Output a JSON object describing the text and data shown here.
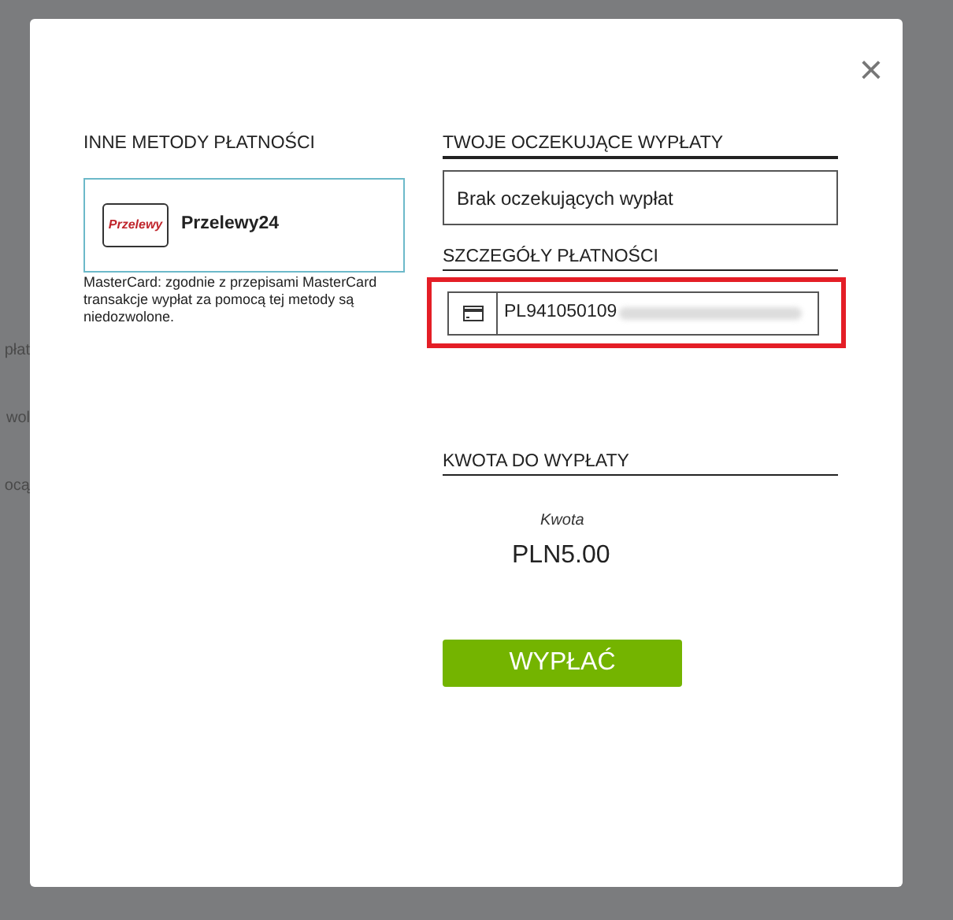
{
  "background_texts": [
    "płat",
    "wol",
    "ocą"
  ],
  "dialog": {
    "close": "×",
    "other_methods": {
      "heading": "INNE METODY PŁATNOŚCI",
      "methods": [
        {
          "logo": "Przelewy",
          "name": "Przelewy24",
          "selected": true
        }
      ],
      "note": "MasterCard: zgodnie z przepisami MasterCard transakcje wypłat za pomocą tej metody są niedozwolone."
    },
    "pending": {
      "heading": "TWOJE OCZEKUJĄCE WYPŁATY",
      "message": "Brak oczekujących wypłat"
    },
    "payment_details": {
      "heading": "SZCZEGÓŁY PŁATNOŚCI",
      "account_value": "PL941050109",
      "highlighted": true
    },
    "amount": {
      "heading": "KWOTA DO WYPŁATY",
      "label": "Kwota",
      "value": "PLN5.00"
    },
    "submit": "WYPŁAĆ"
  }
}
